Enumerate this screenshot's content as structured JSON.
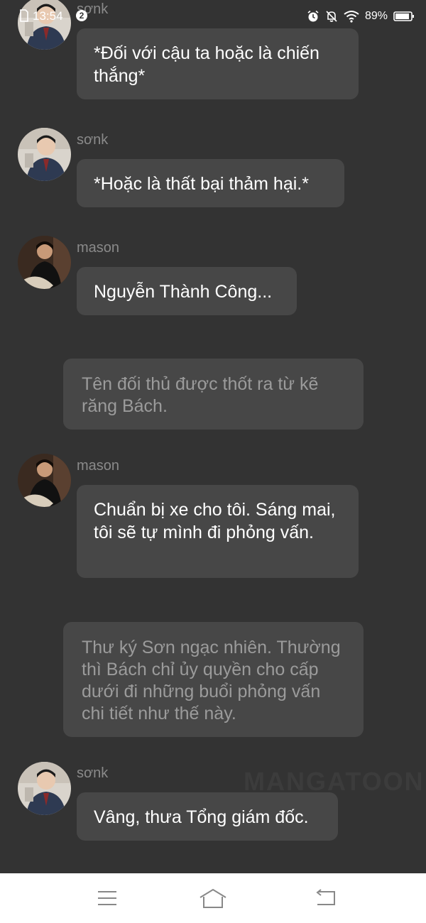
{
  "status_bar": {
    "time": "13:54",
    "notification_count": "2",
    "battery": "89%"
  },
  "messages": [
    {
      "type": "chat",
      "sender": "sơnk",
      "text": "*Đối với cậu ta hoặc là chiến thắng*"
    },
    {
      "type": "chat",
      "sender": "sơnk",
      "text": "*Hoặc là thất bại thảm hại.*"
    },
    {
      "type": "chat",
      "sender": "mason",
      "text": "Nguyễn Thành Công..."
    },
    {
      "type": "narration",
      "text": "Tên đối thủ được thốt ra từ kẽ răng Bách."
    },
    {
      "type": "chat",
      "sender": "mason",
      "text": "Chuẩn bị xe cho tôi. Sáng mai, tôi sẽ tự mình đi phỏng vấn."
    },
    {
      "type": "narration",
      "text": "Thư ký Sơn ngạc nhiên. Thường thì Bách chỉ ủy quyền cho cấp dưới đi những buổi phỏng vấn chi tiết như thế này."
    },
    {
      "type": "chat",
      "sender": "sơnk",
      "text": "Vâng, thưa Tổng giám đốc."
    }
  ],
  "watermark": "MANGATOON",
  "colors": {
    "background": "#333333",
    "bubble": "#474747",
    "narration_text": "#9b9b9b",
    "sender_text": "#8a8a8a"
  }
}
